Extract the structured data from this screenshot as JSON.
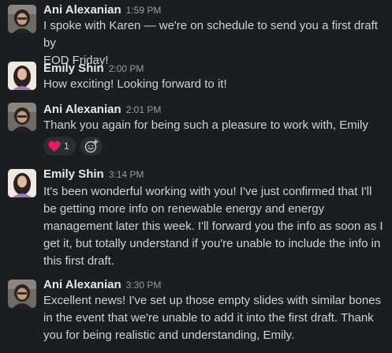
{
  "messages": [
    {
      "author": "Ani Alexanian",
      "time": "1:59 PM",
      "lines": [
        "I spoke with Karen — we're on schedule to send you a first draft by",
        "EOD Friday!"
      ]
    },
    {
      "author": "Emily Shin",
      "time": "2:00 PM",
      "lines": [
        "How exciting! Looking forward to it!"
      ]
    },
    {
      "author": "Ani Alexanian",
      "time": "2:01 PM",
      "lines": [
        "Thank you again for being such a pleasure to work with, Emily"
      ],
      "reactions": [
        {
          "emoji": "heart",
          "count": "1"
        }
      ]
    },
    {
      "author": "Emily Shin",
      "time": "3:14 PM",
      "lines": [
        "It's been wonderful working with you! I've just confirmed that I'll",
        "be getting more info on renewable energy and energy",
        "management later this week. I'll forward you the info as soon as I",
        "get it, but totally understand if you're unable to include the info in",
        "this first draft."
      ]
    },
    {
      "author": "Ani Alexanian",
      "time": "3:30 PM",
      "lines": [
        "Excellent news! I've set up those empty slides with similar bones",
        "in the event that we're unable to add it into the first draft. Thank",
        "you for being realistic and understanding, Emily."
      ]
    }
  ],
  "colors": {
    "background": "#1a1d21",
    "text": "#d1d2d3",
    "author": "#e8e8e8",
    "timestamp": "#9a9b9c",
    "reaction_bg": "#2b2d31",
    "heart": "#e01e5a"
  }
}
